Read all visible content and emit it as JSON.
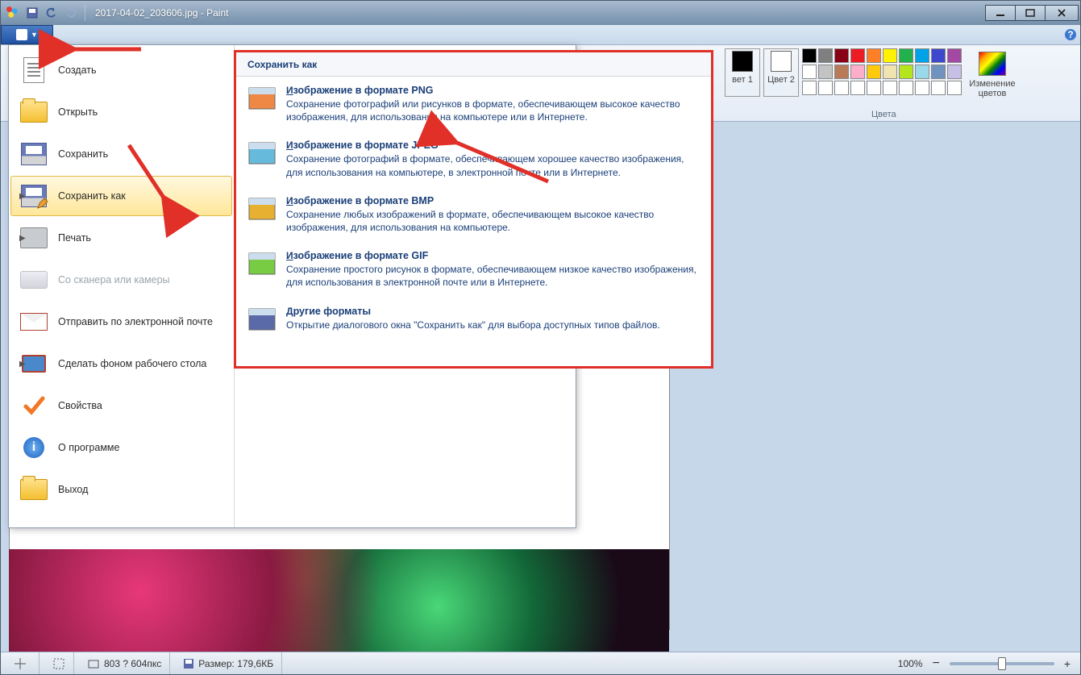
{
  "title": "2017-04-02_203606.jpg - Paint",
  "file_menu": {
    "items": [
      {
        "label": "Создать",
        "icon": "doc"
      },
      {
        "label": "Открыть",
        "icon": "folder"
      },
      {
        "label": "Сохранить",
        "icon": "save"
      },
      {
        "label": "Сохранить как",
        "icon": "save-as",
        "active": true,
        "arrow": true
      },
      {
        "label": "Печать",
        "icon": "printer",
        "arrow": true
      },
      {
        "label": "Со сканера или камеры",
        "icon": "scanner",
        "disabled": true
      },
      {
        "label": "Отправить по электронной почте",
        "icon": "mail"
      },
      {
        "label": "Сделать фоном рабочего стола",
        "icon": "monitor",
        "arrow": true
      },
      {
        "label": "Свойства",
        "icon": "check"
      },
      {
        "label": "О программе",
        "icon": "info"
      },
      {
        "label": "Выход",
        "icon": "folder"
      }
    ]
  },
  "save_as": {
    "header": "Сохранить как",
    "options": [
      {
        "title": "Изображение в формате PNG",
        "desc": "Сохранение фотографий или рисунков в формате, обеспечивающем высокое качество изображения, для использования на компьютере или в Интернете."
      },
      {
        "title": "Изображение в формате JPEG",
        "desc": "Сохранение фотографий в формате, обеспечивающем хорошее качество изображения, для использования на компьютере, в электронной почте или в Интернете."
      },
      {
        "title": "Изображение в формате BMP",
        "desc": "Сохранение любых изображений в формате, обеспечивающем высокое качество изображения, для использования на компьютере."
      },
      {
        "title": "Изображение в формате GIF",
        "desc": "Сохранение простого рисунок в формате, обеспечивающем низкое качество изображения, для использования в электронной почте или в Интернете."
      },
      {
        "title": "Другие форматы",
        "desc": "Открытие диалогового окна \"Сохранить как\" для выбора доступных типов файлов."
      }
    ]
  },
  "ribbon": {
    "color1_label": "вет\n1",
    "color2_label": "Цвет\n2",
    "edit_colors": "Изменение\nцветов",
    "colors_group": "Цвета",
    "palette_row1": [
      "#000000",
      "#7f7f7f",
      "#880015",
      "#ed1c24",
      "#ff7f27",
      "#fff200",
      "#22b14c",
      "#00a2e8",
      "#3f48cc",
      "#a349a4"
    ],
    "palette_row2": [
      "#ffffff",
      "#c3c3c3",
      "#b97a57",
      "#ffaec9",
      "#ffc90e",
      "#efe4b0",
      "#b5e61d",
      "#99d9ea",
      "#7092be",
      "#c8bfe7"
    ],
    "palette_row3": [
      "#ffffff",
      "#ffffff",
      "#ffffff",
      "#ffffff",
      "#ffffff",
      "#ffffff",
      "#ffffff",
      "#ffffff",
      "#ffffff",
      "#ffffff"
    ]
  },
  "status": {
    "dimensions": "803 ? 604пкс",
    "size_label": "Размер: 179,6КБ",
    "zoom": "100%",
    "zoom_minus": "−",
    "zoom_plus": "+"
  }
}
